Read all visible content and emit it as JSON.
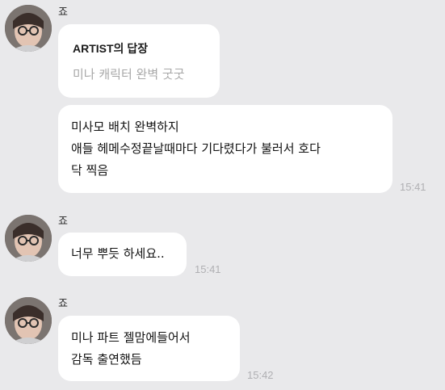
{
  "messages": [
    {
      "sender": "죠",
      "reply": {
        "title": "ARTIST의 답장",
        "text": "미나 캐릭터 완벽 굿굿"
      },
      "lines": [
        "미사모 배치 완벽하지",
        "애들 헤메수정끝날때마다 기다렸다가 불러서 호다",
        "닥 찍음"
      ],
      "time": "15:41"
    },
    {
      "sender": "죠",
      "lines": [
        "너무 뿌듯 하세요.."
      ],
      "time": "15:41"
    },
    {
      "sender": "죠",
      "lines": [
        "미나 파트 젤맘에들어서",
        "감독 출연했듬"
      ],
      "time": "15:42"
    }
  ]
}
